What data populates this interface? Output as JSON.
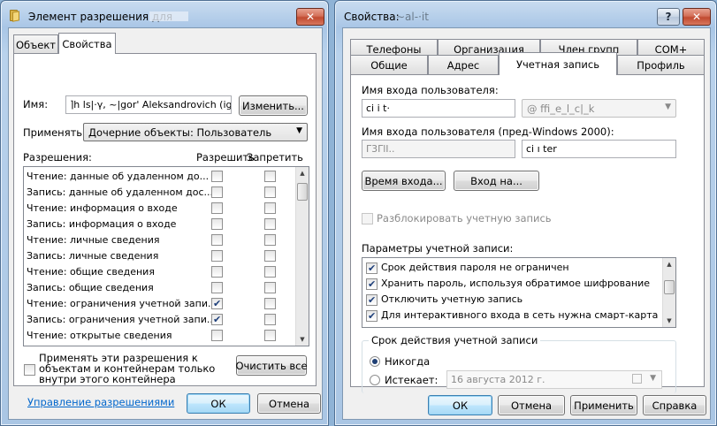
{
  "left_window": {
    "title": "Элемент разрешения для",
    "tabs": [
      "Объект",
      "Свойства"
    ],
    "active_tab": "Свойства",
    "name_label": "Имя:",
    "name_value": "⌉h ls|·γ, ~|gor' Aleksandrovich (igor.l",
    "change_button": "Изменить...",
    "apply_label": "Применять:",
    "apply_value": "Дочерние объекты: Пользователь",
    "permissions_label": "Разрешения:",
    "col_allow": "Разрешить",
    "col_deny": "Запретить",
    "permissions": [
      {
        "name": "Чтение: данные об удаленном до...",
        "allow": false,
        "deny": false
      },
      {
        "name": "Запись: данные об удаленном дос...",
        "allow": false,
        "deny": false
      },
      {
        "name": "Чтение: информация о входе",
        "allow": false,
        "deny": false
      },
      {
        "name": "Запись: информация о входе",
        "allow": false,
        "deny": false
      },
      {
        "name": "Чтение: личные сведения",
        "allow": false,
        "deny": false
      },
      {
        "name": "Запись: личные сведения",
        "allow": false,
        "deny": false
      },
      {
        "name": "Чтение: общие сведения",
        "allow": false,
        "deny": false
      },
      {
        "name": "Запись: общие сведения",
        "allow": false,
        "deny": false
      },
      {
        "name": "Чтение: ограничения учетной запи...",
        "allow": true,
        "deny": false
      },
      {
        "name": "Запись: ограничения учетной запи...",
        "allow": true,
        "deny": false
      },
      {
        "name": "Чтение: открытые сведения",
        "allow": false,
        "deny": false
      }
    ],
    "apply_inside_text": "Применять эти разрешения к объектам и контейнерам только внутри этого контейнера",
    "clear_all_button": "Очистить все",
    "manage_link": "Управление разрешениями",
    "ok_button": "ОК",
    "cancel_button": "Отмена"
  },
  "right_window": {
    "title": "Свойства:",
    "title_name": "∼al-·it",
    "help_button": "?",
    "tabs_row1": [
      "Телефоны",
      "Организация",
      "Член групп",
      "COM+"
    ],
    "tabs_row2": [
      "Общие",
      "Адрес",
      "Учетная запись",
      "Профиль"
    ],
    "active_tab": "Учетная запись",
    "logon_name_label": "Имя входа пользователя:",
    "logon_name_value": "ci i t·",
    "domain_value": "@ ffi_e_l_c|_k",
    "pre2000_label": "Имя входа пользователя (пред-Windows 2000):",
    "pre2000_domain": "Γ3ΓlI..",
    "pre2000_user": "ci ı ter",
    "logon_hours_button": "Время входа...",
    "logon_to_button": "Вход на...",
    "unlock_label": "Разблокировать учетную запись",
    "account_options_label": "Параметры учетной записи:",
    "account_options": [
      {
        "label": "Срок действия пароля не ограничен",
        "checked": true
      },
      {
        "label": "Хранить пароль, используя обратимое шифрование",
        "checked": true
      },
      {
        "label": "Отключить учетную запись",
        "checked": true
      },
      {
        "label": "Для интерактивного входа в сеть нужна смарт-карта",
        "checked": true
      }
    ],
    "expires_group_title": "Срок действия учетной записи",
    "never_label": "Никогда",
    "expires_label": "Истекает:",
    "expires_date": "16  августа  2012 г.",
    "ok_button": "ОК",
    "cancel_button": "Отмена",
    "apply_button": "Применить",
    "help_label": "Справка"
  }
}
